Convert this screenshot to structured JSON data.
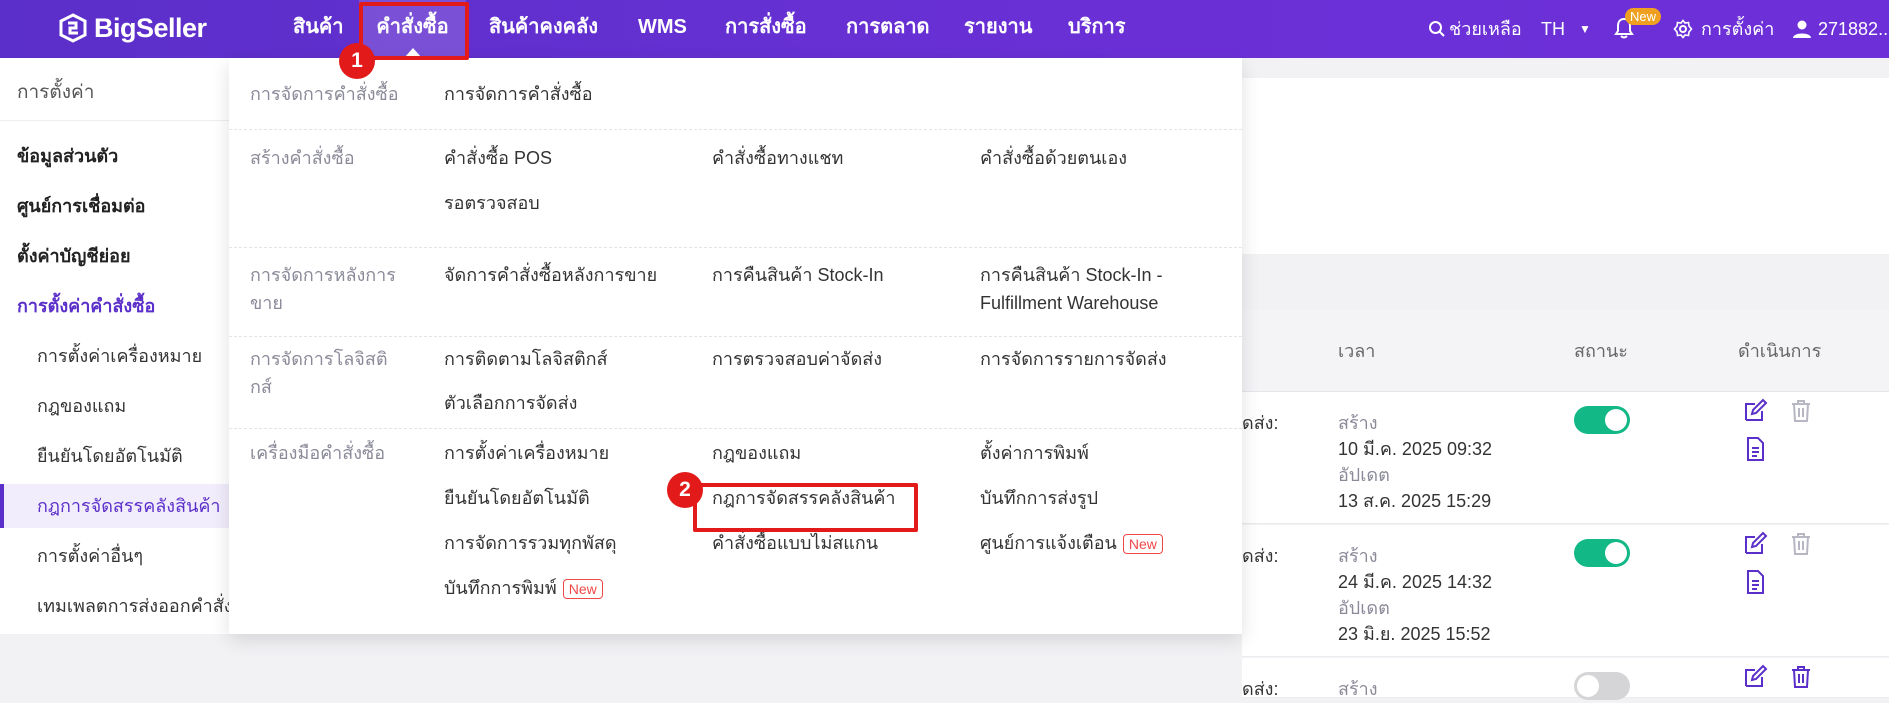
{
  "brand": {
    "name": "BigSeller"
  },
  "nav": {
    "items": [
      "สินค้า",
      "คำสั่งซื้อ",
      "สินค้าคงคลัง",
      "WMS",
      "การสั่งซื้อ",
      "การตลาด",
      "รายงาน",
      "บริการ"
    ],
    "active_index": 1
  },
  "header": {
    "help_label": "ช่วยเหลือ",
    "language": "TH",
    "new_badge": "New",
    "settings_label": "การตั้งค่า",
    "user_label": "271882..."
  },
  "steps": {
    "one": "1",
    "two": "2"
  },
  "sidebar": {
    "title": "การตั้งค่า",
    "items": [
      {
        "label": "ข้อมูลส่วนตัว"
      },
      {
        "label": "ศูนย์การเชื่อมต่อ"
      },
      {
        "label": "ตั้งค่าบัญชีย่อย"
      },
      {
        "label": "การตั้งค่าคำสั่งซื้อ"
      },
      {
        "label": "การตั้งค่าเครื่องหมาย"
      },
      {
        "label": "กฎของแถม"
      },
      {
        "label": "ยืนยันโดยอัตโนมัติ"
      },
      {
        "label": "กฎการจัดสรรคลังสินค้า"
      },
      {
        "label": "การตั้งค่าอื่นๆ"
      },
      {
        "label": "เทมเพลตการส่งออกคำสั่งซื้อ"
      }
    ]
  },
  "dropdown": {
    "sections": [
      {
        "category": "การจัดการคำสั่งซื้อ",
        "links": [
          "การจัดการคำสั่งซื้อ"
        ]
      },
      {
        "category": "สร้างคำสั่งซื้อ",
        "links": [
          "คำสั่งซื้อ POS",
          "คำสั่งซื้อทางแชท",
          "คำสั่งซื้อด้วยตนเอง",
          "รอตรวจสอบ"
        ]
      },
      {
        "category": "การจัดการหลังการขาย",
        "links": [
          "จัดการคำสั่งซื้อหลังการขาย",
          "การคืนสินค้า Stock-In",
          "การคืนสินค้า Stock-In - Fulfillment Warehouse"
        ]
      },
      {
        "category": "การจัดการโลจิสติกส์",
        "links": [
          "การติดตามโลจิสติกส์",
          "การตรวจสอบค่าจัดส่ง",
          "การจัดการรายการจัดส่ง",
          "ตัวเลือกการจัดส่ง"
        ]
      },
      {
        "category": "เครื่องมือคำสั่งซื้อ",
        "links": [
          "การตั้งค่าเครื่องหมาย",
          "กฎของแถม",
          "ตั้งค่าการพิมพ์",
          "ยืนยันโดยอัตโนมัติ",
          "กฎการจัดสรรคลังสินค้า",
          "บันทึกการส่งรูป",
          "การจัดการรวมทุกพัสดุ",
          "คำสั่งซื้อแบบไม่สแกน",
          "ศูนย์การแจ้งเตือน",
          "บันทึกการพิมพ์"
        ]
      }
    ],
    "new_tag": "New"
  },
  "table": {
    "headers": {
      "time": "เวลา",
      "status": "สถานะ",
      "actions": "ดำเนินการ"
    },
    "rows": [
      {
        "partial": "ดส่ง:",
        "created_label": "สร้าง",
        "created": "10 มี.ค. 2025 09:32",
        "updated_label": "อัปเดต",
        "updated": "13 ส.ค. 2025 15:29",
        "enabled": true
      },
      {
        "partial": "ดส่ง:",
        "created_label": "สร้าง",
        "created": "24 มี.ค. 2025 14:32",
        "updated_label": "อัปเดต",
        "updated": "23 มิ.ย. 2025 15:52",
        "enabled": true
      },
      {
        "partial": "ดส่ง:",
        "created_label": "สร้าง",
        "enabled": false
      }
    ]
  },
  "colors": {
    "brand": "#5b2fc9",
    "highlight": "#e21a1a",
    "toggle_on": "#12b886"
  }
}
